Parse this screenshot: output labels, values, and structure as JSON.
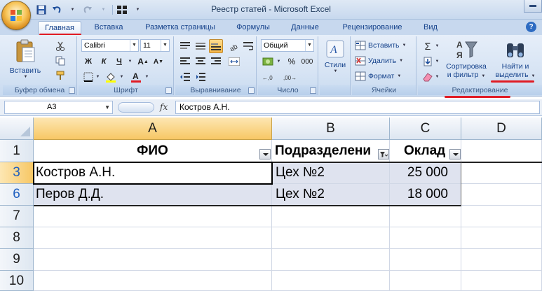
{
  "window": {
    "title": "Реестр статей - Microsoft Excel"
  },
  "tabs": [
    {
      "label": "Главная",
      "active": true
    },
    {
      "label": "Вставка"
    },
    {
      "label": "Разметка страницы"
    },
    {
      "label": "Формулы"
    },
    {
      "label": "Данные"
    },
    {
      "label": "Рецензирование"
    },
    {
      "label": "Вид"
    }
  ],
  "ribbon": {
    "clipboard": {
      "label": "Буфер обмена",
      "paste": "Вставить"
    },
    "font": {
      "label": "Шрифт",
      "name": "Calibri",
      "size": "11",
      "bold": "Ж",
      "italic": "К",
      "underline": "Ч"
    },
    "alignment": {
      "label": "Выравнивание"
    },
    "number": {
      "label": "Число",
      "format": "Общий",
      "thousands": "000"
    },
    "styles": {
      "label": "Стили"
    },
    "cells": {
      "label": "Ячейки",
      "insert": "Вставить",
      "delete": "Удалить",
      "format": "Формат"
    },
    "editing": {
      "label": "Редактирование",
      "sort_line1": "Сортировка",
      "sort_line2": "и фильтр",
      "find_line1": "Найти и",
      "find_line2": "выделить",
      "sigma": "Σ"
    }
  },
  "formula_bar": {
    "name_box": "A3",
    "fx": "fx",
    "content": "Костров А.Н."
  },
  "sheet": {
    "columns": [
      "A",
      "B",
      "C",
      "D"
    ],
    "rows": [
      "1",
      "3",
      "6",
      "7",
      "8",
      "9",
      "10"
    ],
    "header": {
      "a": "ФИО",
      "b": "Подразделени",
      "c": "Оклад"
    },
    "data": [
      {
        "name": "Костров А.Н.",
        "dept": "Цех №2",
        "salary": "25 000"
      },
      {
        "name": "Перов Д.Д.",
        "dept": "Цех №2",
        "salary": "18 000"
      }
    ]
  },
  "colors": {
    "accent_red": "#e01b24",
    "selected_header": "#f7c765",
    "ribbon_blue": "#d7e4f4"
  }
}
